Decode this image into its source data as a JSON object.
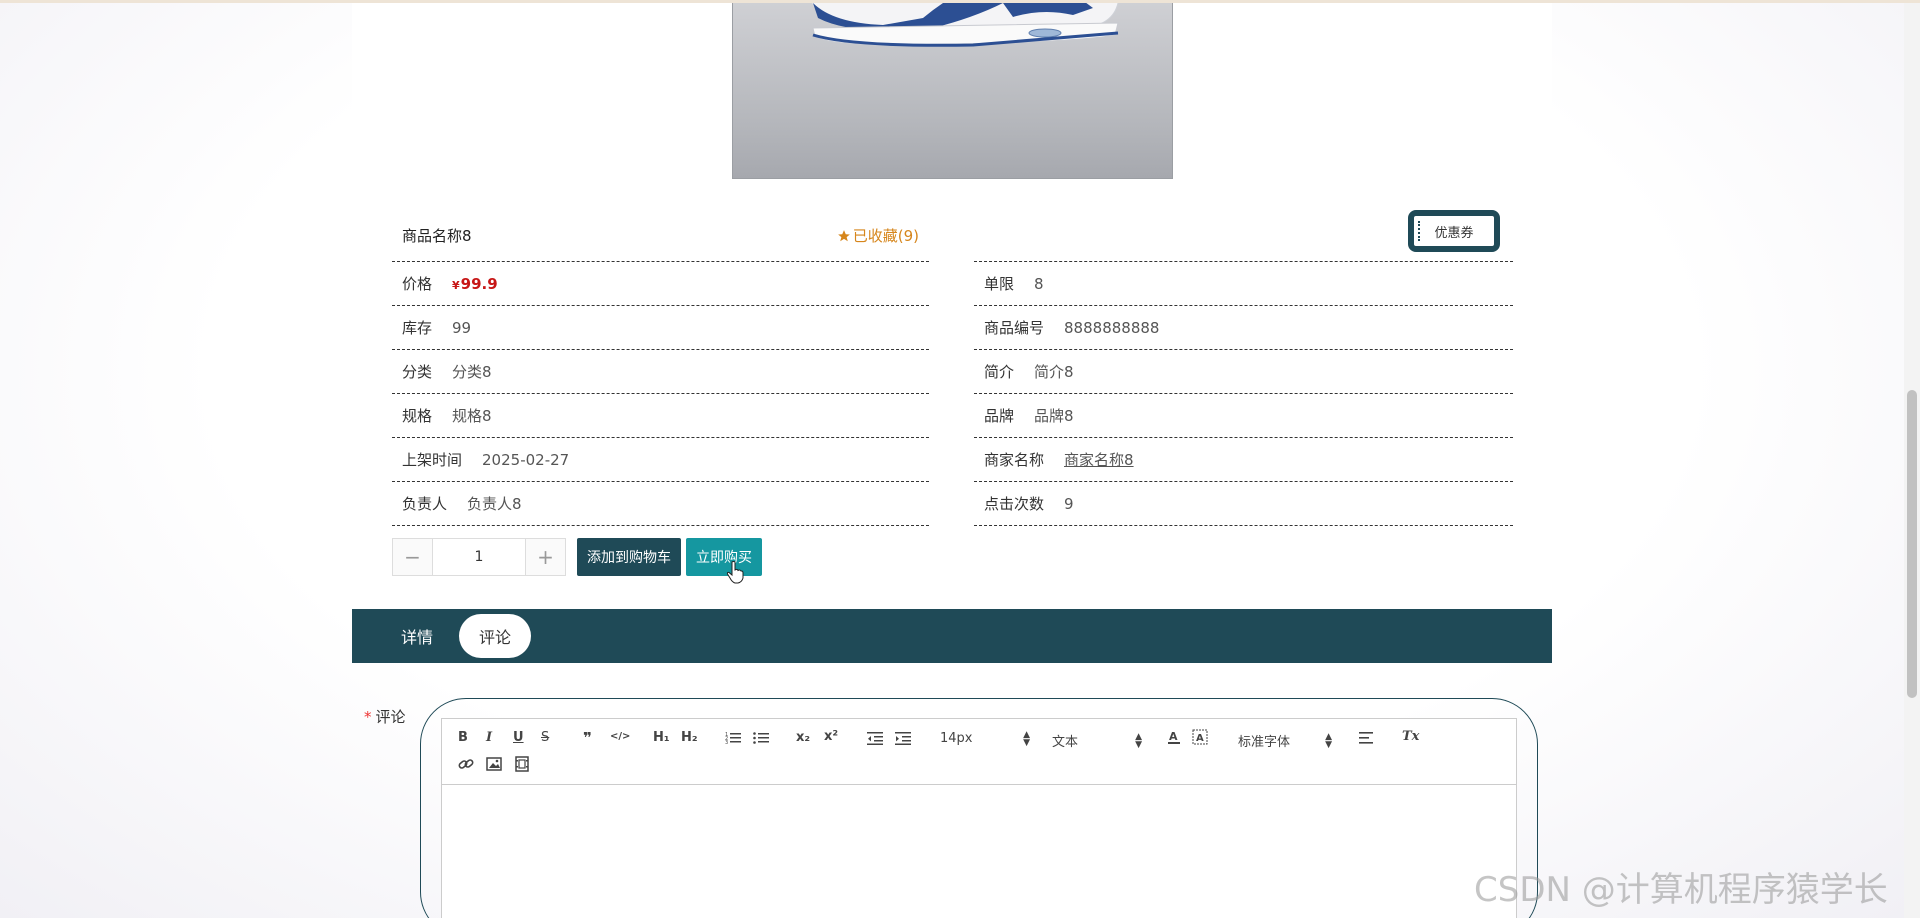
{
  "product": {
    "name": "商品名称8",
    "favorite_label": "已收藏(9)",
    "coupon_label": "优惠券",
    "details_left": [
      {
        "label": "价格",
        "yen": "¥",
        "value": "99.9"
      },
      {
        "label": "库存",
        "value": "99"
      },
      {
        "label": "分类",
        "value": "分类8"
      },
      {
        "label": "规格",
        "value": "规格8"
      },
      {
        "label": "上架时间",
        "value": "2025-02-27"
      },
      {
        "label": "负责人",
        "value": "负责人8"
      }
    ],
    "details_right": [
      {
        "label": "单限",
        "value": "8"
      },
      {
        "label": "商品编号",
        "value": "8888888888"
      },
      {
        "label": "简介",
        "value": "简介8"
      },
      {
        "label": "品牌",
        "value": "品牌8"
      },
      {
        "label": "商家名称",
        "value": "商家名称8"
      },
      {
        "label": "点击次数",
        "value": "9"
      }
    ]
  },
  "actions": {
    "qty_minus": "−",
    "qty_value": "1",
    "qty_plus": "+",
    "add_to_cart": "添加到购物车",
    "buy_now": "立即购买"
  },
  "tabs": [
    {
      "label": "详情",
      "active": false
    },
    {
      "label": "评论",
      "active": true
    }
  ],
  "comment": {
    "required_mark": "*",
    "label": "评论"
  },
  "editor_toolbar": {
    "bold": "B",
    "italic": "I",
    "underline": "U",
    "strike": "S",
    "quote": "❞",
    "code": "</>",
    "h1": "H₁",
    "h2": "H₂",
    "subscript": "x₂",
    "superscript": "x²",
    "font_size": "14px",
    "header": "文本",
    "font_family": "标准字体",
    "clear": "Tx"
  },
  "watermark": "CSDN @计算机程序猿学长",
  "colors": {
    "primary": "#1f4a57",
    "buy": "#1597a0",
    "price": "#c71616",
    "favorite": "#d6861c"
  }
}
